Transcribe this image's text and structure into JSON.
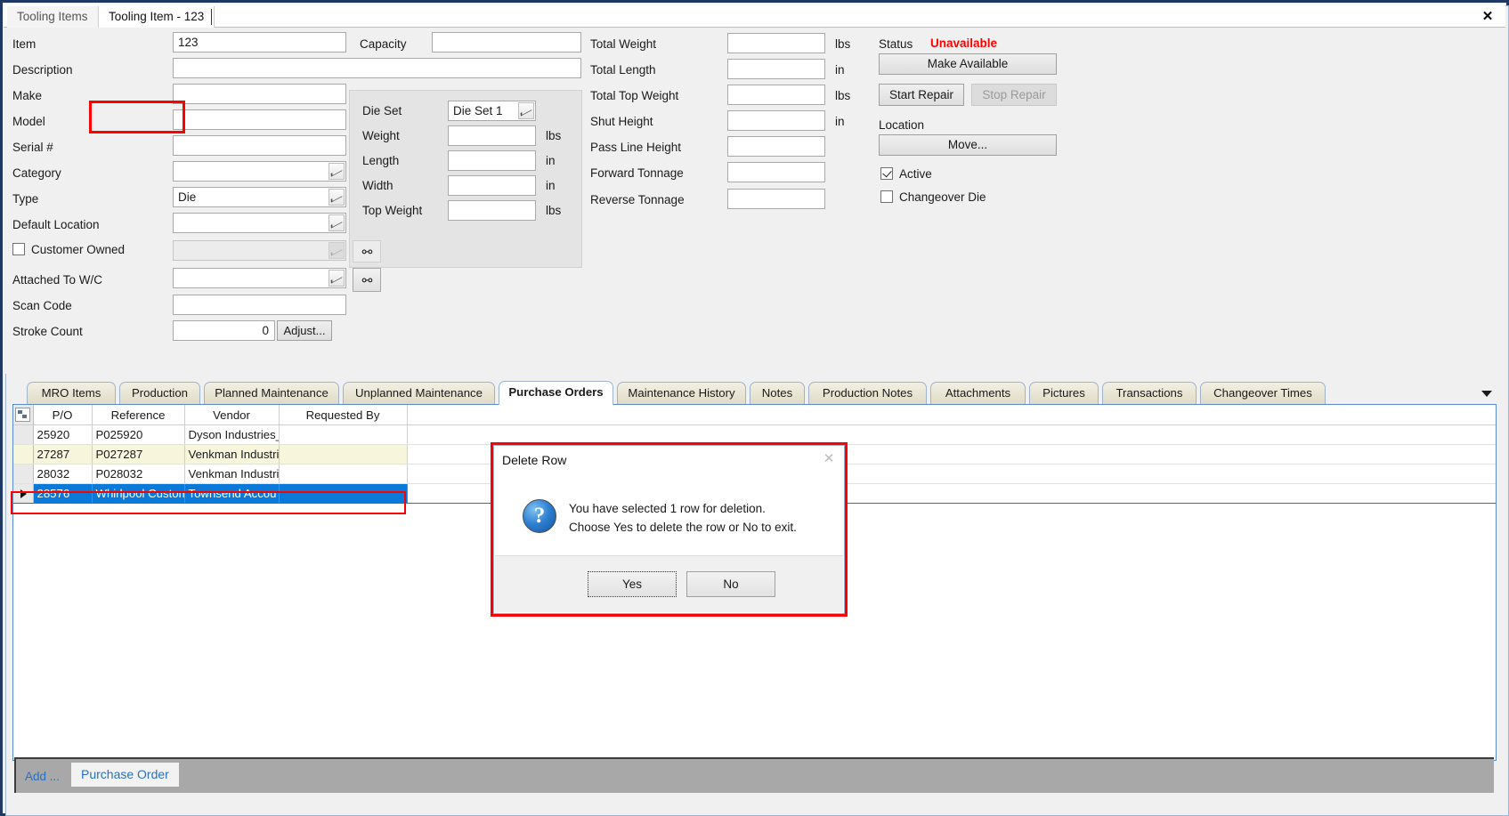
{
  "window": {
    "close_label": "✕"
  },
  "doc_tabs": [
    {
      "label": "Tooling Items",
      "active": false
    },
    {
      "label": "Tooling Item - 123",
      "active": true
    }
  ],
  "form": {
    "left_fields": [
      {
        "label": "Item",
        "value": "123",
        "type": "text"
      },
      {
        "label": "Description",
        "value": "",
        "type": "text"
      },
      {
        "label": "Make",
        "value": "",
        "type": "text"
      },
      {
        "label": "Model",
        "value": "",
        "type": "text"
      },
      {
        "label": "Serial #",
        "value": "",
        "type": "text"
      },
      {
        "label": "Category",
        "value": "",
        "type": "combo"
      },
      {
        "label": "Type",
        "value": "Die",
        "type": "combo"
      },
      {
        "label": "Default Location",
        "value": "",
        "type": "combo"
      },
      {
        "label": "Attached To W/C",
        "value": "",
        "type": "combo"
      },
      {
        "label": "Scan Code",
        "value": "",
        "type": "text"
      },
      {
        "label": "Stroke Count",
        "value": "0",
        "type": "numeric"
      }
    ],
    "customer_owned": {
      "label": "Customer Owned",
      "checked": false,
      "combo_value": ""
    },
    "adjust_button": "Adjust...",
    "capacity": {
      "label": "Capacity",
      "value": ""
    },
    "die_group": {
      "die_set": {
        "label": "Die Set",
        "value": "Die Set 1"
      },
      "rows": [
        {
          "label": "Weight",
          "value": "",
          "unit": "lbs"
        },
        {
          "label": "Length",
          "value": "",
          "unit": "in"
        },
        {
          "label": "Width",
          "value": "",
          "unit": "in"
        },
        {
          "label": "Top Weight",
          "value": "",
          "unit": "lbs"
        }
      ]
    },
    "totals": [
      {
        "label": "Total Weight",
        "value": "",
        "unit": "lbs"
      },
      {
        "label": "Total Length",
        "value": "",
        "unit": "in"
      },
      {
        "label": "Total Top Weight",
        "value": "",
        "unit": "lbs"
      },
      {
        "label": "Shut Height",
        "value": "",
        "unit": "in"
      },
      {
        "label": "Pass Line Height",
        "value": "",
        "unit": ""
      },
      {
        "label": "Forward Tonnage",
        "value": "",
        "unit": ""
      },
      {
        "label": "Reverse Tonnage",
        "value": "",
        "unit": ""
      }
    ],
    "status": {
      "label": "Status",
      "value": "Unavailable",
      "value_color": "#ff0000",
      "make_available_button": "Make Available",
      "start_repair_button": "Start Repair",
      "stop_repair_button": "Stop Repair",
      "location_label": "Location",
      "move_button": "Move...",
      "active_checkbox": {
        "label": "Active",
        "checked": true
      },
      "changeover_checkbox": {
        "label": "Changeover Die",
        "checked": false
      }
    },
    "search_icon": "binoculars"
  },
  "bottom_tabs": [
    {
      "label": "MRO Items",
      "active": false
    },
    {
      "label": "Production",
      "active": false
    },
    {
      "label": "Planned Maintenance",
      "active": false
    },
    {
      "label": "Unplanned Maintenance",
      "active": false
    },
    {
      "label": "Purchase Orders",
      "active": true
    },
    {
      "label": "Maintenance History",
      "active": false
    },
    {
      "label": "Notes",
      "active": false
    },
    {
      "label": "Production Notes",
      "active": false
    },
    {
      "label": "Attachments",
      "active": false
    },
    {
      "label": "Pictures",
      "active": false
    },
    {
      "label": "Transactions",
      "active": false
    },
    {
      "label": "Changeover Times",
      "active": false
    }
  ],
  "grid": {
    "columns": [
      "P/O",
      "Reference",
      "Vendor",
      "Requested By"
    ],
    "rows": [
      {
        "cells": [
          "25920",
          "P025920",
          "Dyson Industries_",
          ""
        ],
        "state": "normal"
      },
      {
        "cells": [
          "27287",
          "P027287",
          "Venkman Industri",
          ""
        ],
        "state": "alt"
      },
      {
        "cells": [
          "28032",
          "P028032",
          "Venkman Industri",
          ""
        ],
        "state": "normal"
      },
      {
        "cells": [
          "28576",
          "Whirlpool Custom",
          "Townsend Accou",
          ""
        ],
        "state": "selected"
      }
    ]
  },
  "command_bar": {
    "add_label": "Add ...",
    "purchase_order_label": "Purchase Order"
  },
  "dialog": {
    "title": "Delete Row",
    "close_label": "✕",
    "icon": "question-icon",
    "icon_glyph": "?",
    "message_line1": "You have selected 1 row for deletion.",
    "message_line2": "Choose Yes to delete the row or No to exit.",
    "yes_label": "Yes",
    "no_label": "No"
  }
}
